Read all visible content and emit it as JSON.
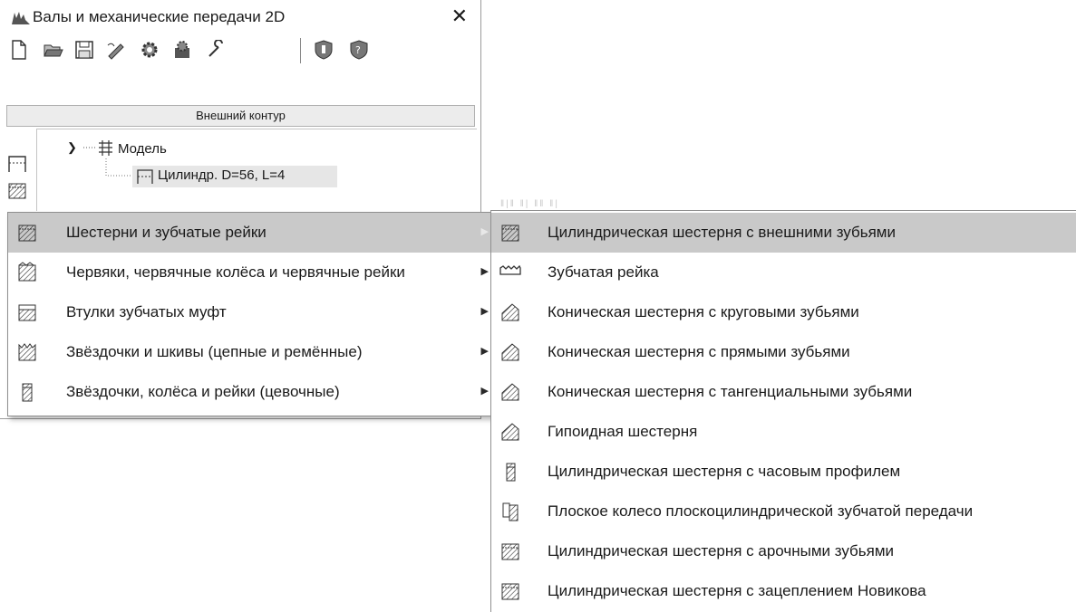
{
  "window": {
    "title": "Валы и механические передачи 2D",
    "close_label": "✕",
    "section_label": "Внешний контур"
  },
  "toolbar": {
    "buttons": [
      "new-file-icon",
      "open-folder-icon",
      "save-icon",
      "edit-icon",
      "gear-settings-icon",
      "gear-box-icon",
      "wrench-icon",
      "shield-icon",
      "shield-question-icon"
    ]
  },
  "tree": {
    "root_label": "Модель",
    "child_label": "Цилиндр. D=56, L=4"
  },
  "menu": {
    "items": [
      {
        "label": "Шестерни и зубчатые рейки",
        "icon": "gear-hatch-icon",
        "highlighted": true
      },
      {
        "label": "Червяки, червячные колёса и червячные рейки",
        "icon": "worm-gear-icon"
      },
      {
        "label": "Втулки зубчатых муфт",
        "icon": "coupling-hub-icon"
      },
      {
        "label": "Звёздочки и шкивы (цепные  и ремённые)",
        "icon": "sprocket-icon"
      },
      {
        "label": "Звёздочки, колёса и рейки (цевочные)",
        "icon": "pin-wheel-icon"
      }
    ]
  },
  "submenu": {
    "items": [
      {
        "label": "Цилиндрическая шестерня с внешними зубьями",
        "icon": "spur-gear-icon",
        "highlighted": true
      },
      {
        "label": "Зубчатая рейка",
        "icon": "gear-rack-icon"
      },
      {
        "label": "Коническая шестерня с круговыми зубьями",
        "icon": "bevel-gear-icon"
      },
      {
        "label": "Коническая шестерня с прямыми зубьями",
        "icon": "bevel-gear-icon"
      },
      {
        "label": "Коническая шестерня с тангенциальными зубьями",
        "icon": "bevel-gear-icon"
      },
      {
        "label": "Гипоидная шестерня",
        "icon": "bevel-gear-icon"
      },
      {
        "label": "Цилиндрическая шестерня с часовым профилем",
        "icon": "narrow-gear-icon"
      },
      {
        "label": "Плоское колесо плоскоцилиндрической зубчатой передачи",
        "icon": "face-gear-icon"
      },
      {
        "label": "Цилиндрическая шестерня с арочными зубьями",
        "icon": "spur-gear-icon"
      },
      {
        "label": "Цилиндрическая шестерня с зацеплением Новикова",
        "icon": "spur-gear-icon"
      }
    ]
  },
  "colors": {
    "highlight": "#c9c9c9",
    "border": "#8f8f8f",
    "text": "#1a1a1a"
  }
}
